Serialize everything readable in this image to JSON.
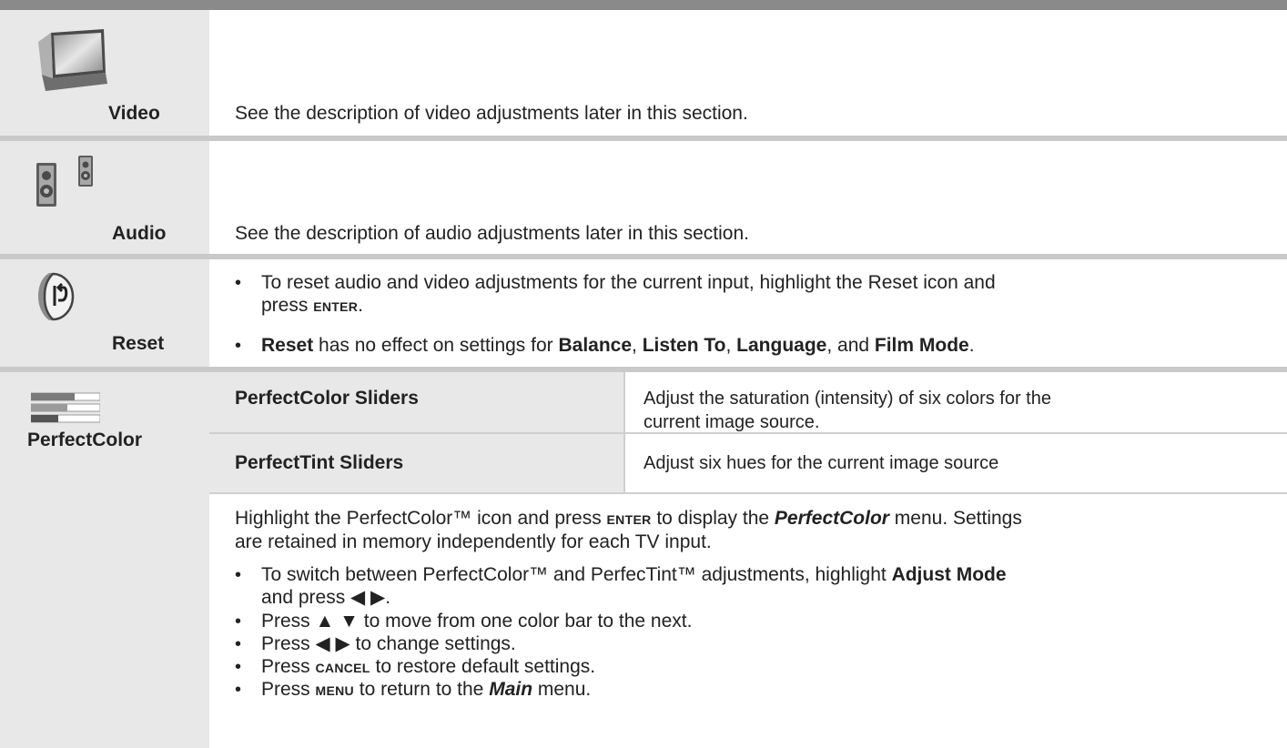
{
  "rows": {
    "video": {
      "name": "Video",
      "description": "See the description of video adjustments later in this section."
    },
    "audio": {
      "name": "Audio",
      "description": "See the description of audio adjustments later in this section."
    },
    "reset": {
      "name": "Reset",
      "bullet1_line1": "To reset audio and video adjustments for the current input, highlight the Reset icon and",
      "bullet1_line2_pre": "press",
      "bullet1_key": "ENTER",
      "bullet1_line2_post": ".",
      "bullet2": {
        "b1": "Reset",
        "t1": " has no effect on settings for ",
        "b2": "Balance",
        "t2": ", ",
        "b3": "Listen To",
        "t3": ", ",
        "b4": "Language",
        "t4": ", and ",
        "b5": "Film Mode",
        "t5": "."
      }
    },
    "perfectcolor": {
      "name": "PerfectColor",
      "sub_rows": [
        {
          "label": "PerfectColor Sliders",
          "text_line1": "Adjust the saturation (intensity) of six colors for the",
          "text_line2": "current image source."
        },
        {
          "label": "PerfectTint Sliders",
          "text_line1": "Adjust six hues for the current image source"
        }
      ],
      "intro": {
        "pre": "Highlight the PerfectColor™ icon and press ",
        "key": "ENTER",
        "mid": " to display the ",
        "menu": "PerfectColor",
        "post": " menu.  Settings",
        "line2": "are retained in memory independently for each TV input."
      },
      "bullets": {
        "b1_pre": "To switch between PerfectColor™ and PerfecTint™ adjustments, highlight ",
        "b1_bold": "Adjust Mode",
        "b1_line2": "and press ◀ ▶.",
        "b2": "Press ▲ ▼ to move from one color bar to the next.",
        "b3": "Press ◀ ▶ to change settings.",
        "b4_pre": "Press ",
        "b4_key": "CANCEL",
        "b4_post": " to restore default settings.",
        "b5_pre": "Press ",
        "b5_key": "MENU",
        "b5_mid": " to return to the ",
        "b5_menu": "Main",
        "b5_post": " menu."
      }
    }
  },
  "bullet_char": "•"
}
